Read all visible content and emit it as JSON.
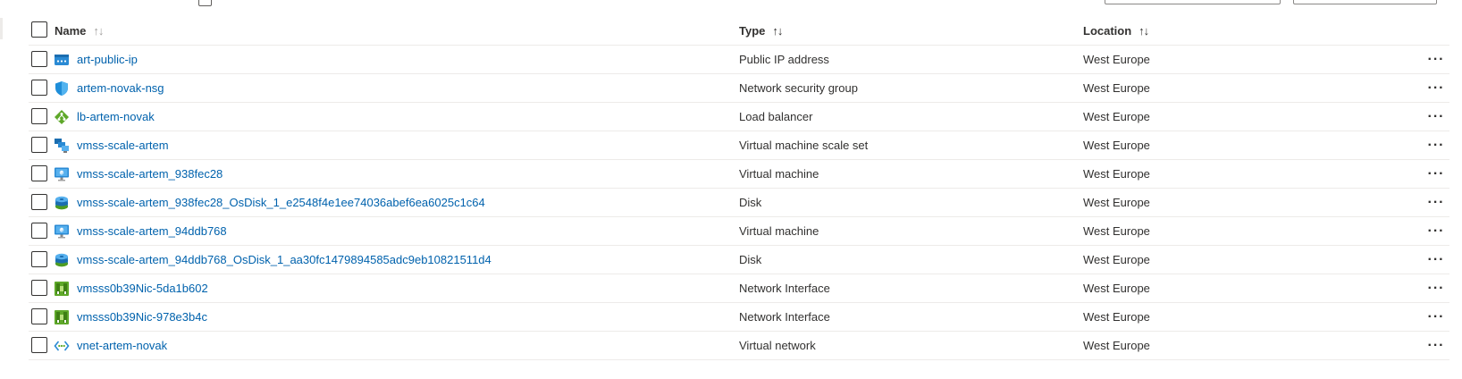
{
  "columns": {
    "name": "Name",
    "type": "Type",
    "location": "Location"
  },
  "sort_glyphs": {
    "name": "↑↓",
    "type": "↑↓",
    "location": "↑↓"
  },
  "more_label": "···",
  "rows": [
    {
      "name": "art-public-ip",
      "type": "Public IP address",
      "location": "West Europe",
      "icon": "public-ip-icon"
    },
    {
      "name": "artem-novak-nsg",
      "type": "Network security group",
      "location": "West Europe",
      "icon": "shield-icon"
    },
    {
      "name": "lb-artem-novak",
      "type": "Load balancer",
      "location": "West Europe",
      "icon": "load-balancer-icon"
    },
    {
      "name": "vmss-scale-artem",
      "type": "Virtual machine scale set",
      "location": "West Europe",
      "icon": "vmss-icon"
    },
    {
      "name": "vmss-scale-artem_938fec28",
      "type": "Virtual machine",
      "location": "West Europe",
      "icon": "monitor-icon"
    },
    {
      "name": "vmss-scale-artem_938fec28_OsDisk_1_e2548f4e1ee74036abef6ea6025c1c64",
      "type": "Disk",
      "location": "West Europe",
      "icon": "disk-icon"
    },
    {
      "name": "vmss-scale-artem_94ddb768",
      "type": "Virtual machine",
      "location": "West Europe",
      "icon": "monitor-icon"
    },
    {
      "name": "vmss-scale-artem_94ddb768_OsDisk_1_aa30fc1479894585adc9eb10821511d4",
      "type": "Disk",
      "location": "West Europe",
      "icon": "disk-icon"
    },
    {
      "name": "vmsss0b39Nic-5da1b602",
      "type": "Network Interface",
      "location": "West Europe",
      "icon": "nic-icon"
    },
    {
      "name": "vmsss0b39Nic-978e3b4c",
      "type": "Network Interface",
      "location": "West Europe",
      "icon": "nic-icon"
    },
    {
      "name": "vnet-artem-novak",
      "type": "Virtual network",
      "location": "West Europe",
      "icon": "vnet-icon"
    }
  ]
}
